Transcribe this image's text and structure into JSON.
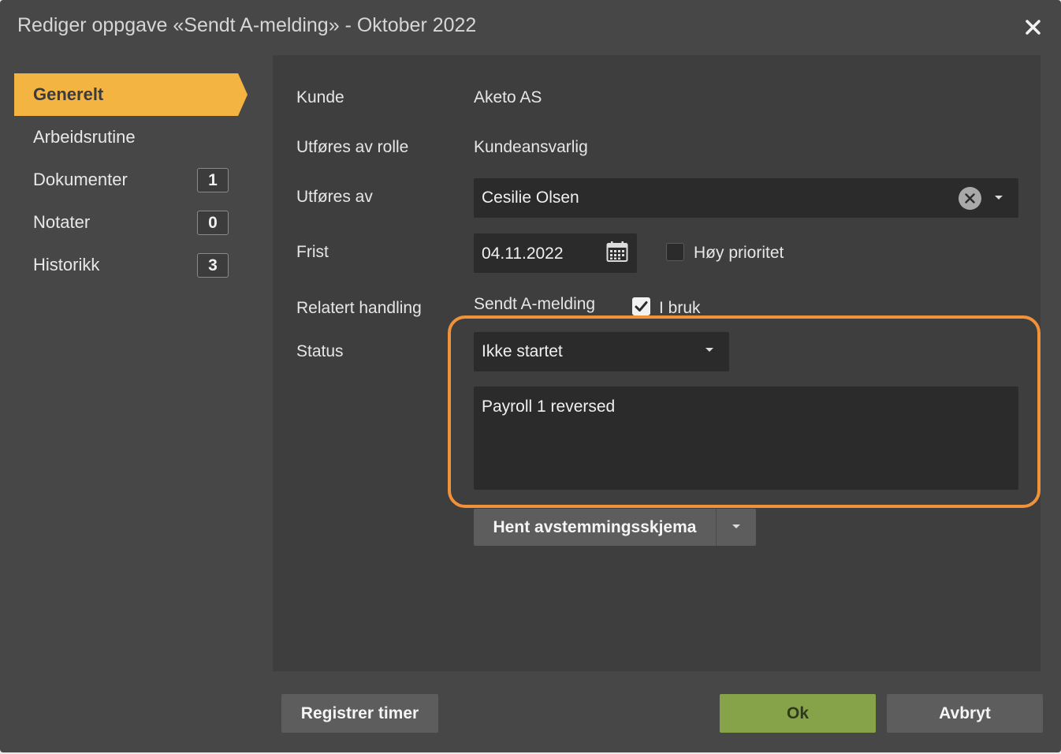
{
  "dialog": {
    "title": "Rediger oppgave «Sendt A-melding» - Oktober 2022"
  },
  "sidebar": {
    "items": [
      {
        "label": "Generelt",
        "active": true
      },
      {
        "label": "Arbeidsrutine"
      },
      {
        "label": "Dokumenter",
        "count": "1"
      },
      {
        "label": "Notater",
        "count": "0"
      },
      {
        "label": "Historikk",
        "count": "3"
      }
    ]
  },
  "form": {
    "kunde_label": "Kunde",
    "kunde_value": "Aketo AS",
    "rolle_label": "Utføres av rolle",
    "rolle_value": "Kundeansvarlig",
    "utfores_label": "Utføres av",
    "utfores_value": "Cesilie Olsen",
    "frist_label": "Frist",
    "frist_value": "04.11.2022",
    "prioritet_label": "Høy prioritet",
    "prioritet_checked": false,
    "relatert_label": "Relatert handling",
    "relatert_value": "Sendt A-melding",
    "i_bruk_label": "I bruk",
    "i_bruk_checked": true,
    "status_label": "Status",
    "status_value": "Ikke startet",
    "comment_value": "Payroll 1 reversed",
    "hent_label": "Hent avstemmingsskjema"
  },
  "footer": {
    "register_label": "Registrer timer",
    "ok_label": "Ok",
    "cancel_label": "Avbryt"
  },
  "colors": {
    "active_tab": "#f3b442",
    "ok_button": "#86a34a",
    "highlight": "#f0923a"
  }
}
